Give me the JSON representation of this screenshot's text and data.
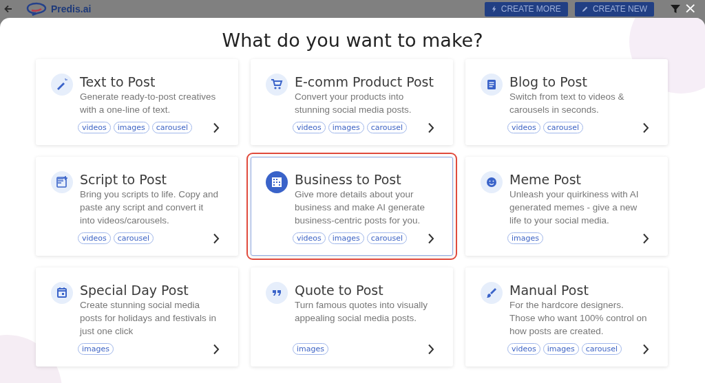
{
  "topbar": {
    "logo": "Predis.ai",
    "buttons": [
      "CREATE MORE",
      "CREATE NEW"
    ]
  },
  "modal": {
    "close": "×",
    "title": "What do you want to make?"
  },
  "cards": [
    {
      "title": "Text to Post",
      "description": "Generate ready-to-post creatives with a one-line of text.",
      "tags": [
        "videos",
        "images",
        "carousel"
      ],
      "selected": false
    },
    {
      "title": "E-comm Product Post",
      "description": "Convert your products into stunning social media posts.",
      "tags": [
        "videos",
        "images",
        "carousel"
      ],
      "selected": false
    },
    {
      "title": "Blog to Post",
      "description": "Switch from text to videos & carousels in seconds.",
      "tags": [
        "videos",
        "carousel"
      ],
      "selected": false
    },
    {
      "title": "Script to Post",
      "description": "Bring you scripts to life. Copy and paste any script and convert it into videos/carousels.",
      "tags": [
        "videos",
        "carousel"
      ],
      "selected": false
    },
    {
      "title": "Business to Post",
      "description": "Give more details about your business and make AI generate business-centric posts for you.",
      "tags": [
        "videos",
        "images",
        "carousel"
      ],
      "selected": true
    },
    {
      "title": "Meme Post",
      "description": "Unleash your quirkiness with AI generated memes - give a new life to your social media.",
      "tags": [
        "images"
      ],
      "selected": false
    },
    {
      "title": "Special Day Post",
      "description": "Create stunning social media posts for holidays and festivals in just one click",
      "tags": [
        "images"
      ],
      "selected": false
    },
    {
      "title": "Quote to Post",
      "description": "Turn famous quotes into visually appealing social media posts.",
      "tags": [
        "images"
      ],
      "selected": false
    },
    {
      "title": "Manual Post",
      "description": "For the hardcore designers. Those who want 100% control on how posts are created.",
      "tags": [
        "videos",
        "images",
        "carousel"
      ],
      "selected": false
    }
  ]
}
